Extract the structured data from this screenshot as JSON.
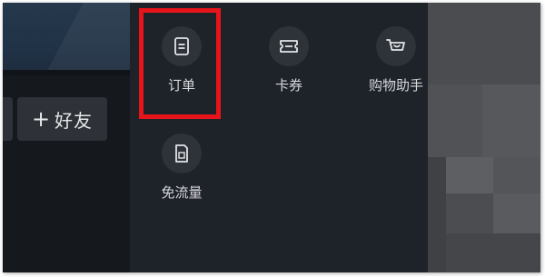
{
  "left_panel": {
    "add_friend_plus": "+",
    "add_friend_label": "好友"
  },
  "menu": {
    "items": [
      {
        "label": "订单",
        "icon": "document-icon"
      },
      {
        "label": "卡券",
        "icon": "ticket-icon"
      },
      {
        "label": "购物助手",
        "icon": "shopping-basket-icon"
      },
      {
        "label": "免流量",
        "icon": "sim-card-icon"
      }
    ],
    "highlighted_item": "订单"
  },
  "colors": {
    "highlight_border": "#e8141b",
    "panel_bg": "#1e2229",
    "icon_circle_bg": "#2e3339"
  }
}
